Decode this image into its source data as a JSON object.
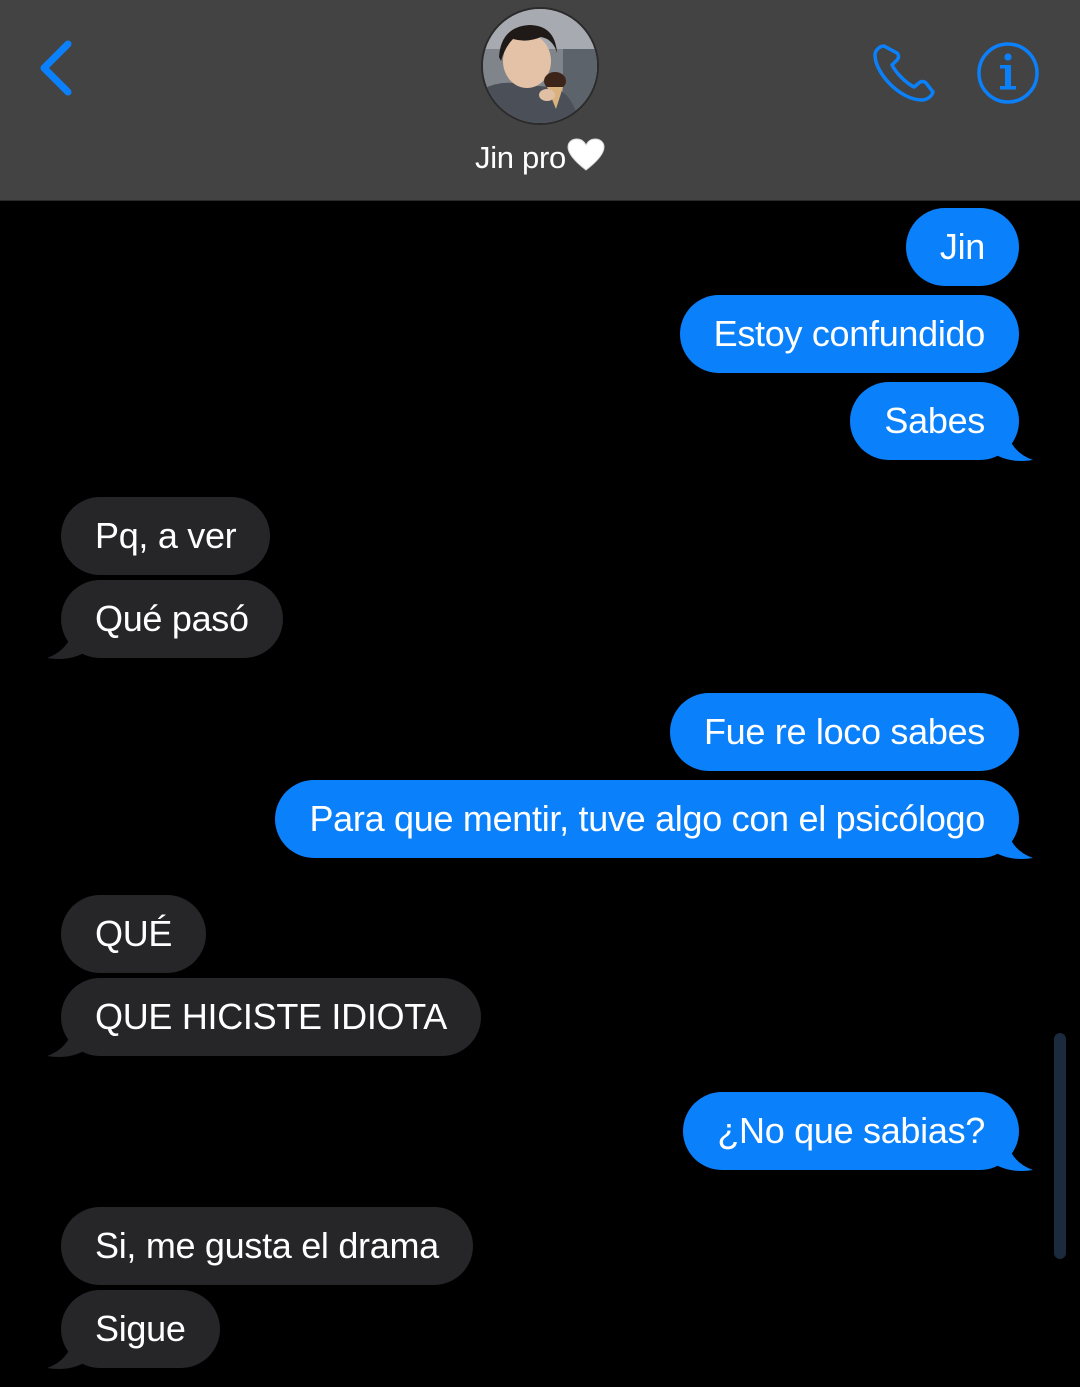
{
  "header": {
    "contact_name": "Jin pro",
    "back_icon": "chevron-left-icon",
    "phone_icon": "phone-icon",
    "info_icon": "info-icon",
    "accent_color": "#0b80fb"
  },
  "messages": [
    {
      "from": "me",
      "text": "Jin"
    },
    {
      "from": "me",
      "text": "Estoy confundido"
    },
    {
      "from": "me",
      "text": "Sabes"
    },
    {
      "from": "them",
      "text": "Pq, a ver"
    },
    {
      "from": "them",
      "text": "Qué pasó"
    },
    {
      "from": "me",
      "text": "Fue re loco sabes"
    },
    {
      "from": "me",
      "text": "Para que mentir, tuve algo con el psicólogo"
    },
    {
      "from": "them",
      "text": "QUÉ"
    },
    {
      "from": "them",
      "text": "QUE HICISTE IDIOTA"
    },
    {
      "from": "me",
      "text": "¿No que sabias?"
    },
    {
      "from": "them",
      "text": "Si, me gusta el drama"
    },
    {
      "from": "them",
      "text": "Sigue"
    }
  ],
  "colors": {
    "sent_bubble": "#0b80fb",
    "received_bubble": "#262629",
    "background": "#000000",
    "header_bg": "#434343"
  }
}
